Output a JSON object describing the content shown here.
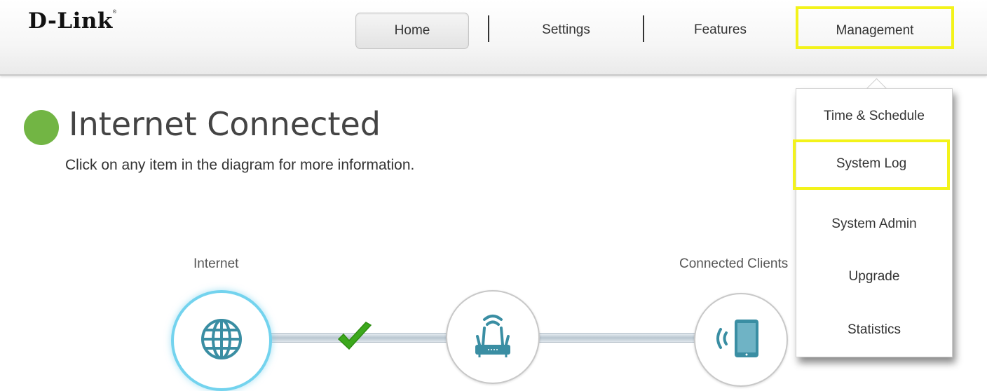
{
  "brand": {
    "logo": "D-Link",
    "logo_mark": "®"
  },
  "nav": {
    "home": "Home",
    "settings": "Settings",
    "features": "Features",
    "management": "Management",
    "highlight_color": "#f3f31a"
  },
  "status": {
    "title": "Internet Connected",
    "subtitle": "Click on any item in the diagram for more information.",
    "indicator_color": "#72b544"
  },
  "diagram": {
    "internet_label": "Internet",
    "clients_label": "Connected Clients",
    "nodes": [
      "globe-icon",
      "router-icon",
      "wireless-client-icon"
    ],
    "link_status_icon": "checkmark-icon"
  },
  "management_menu": {
    "items": [
      "Time & Schedule",
      "System Log",
      "System Admin",
      "Upgrade",
      "Statistics"
    ],
    "highlighted": "System Log"
  }
}
